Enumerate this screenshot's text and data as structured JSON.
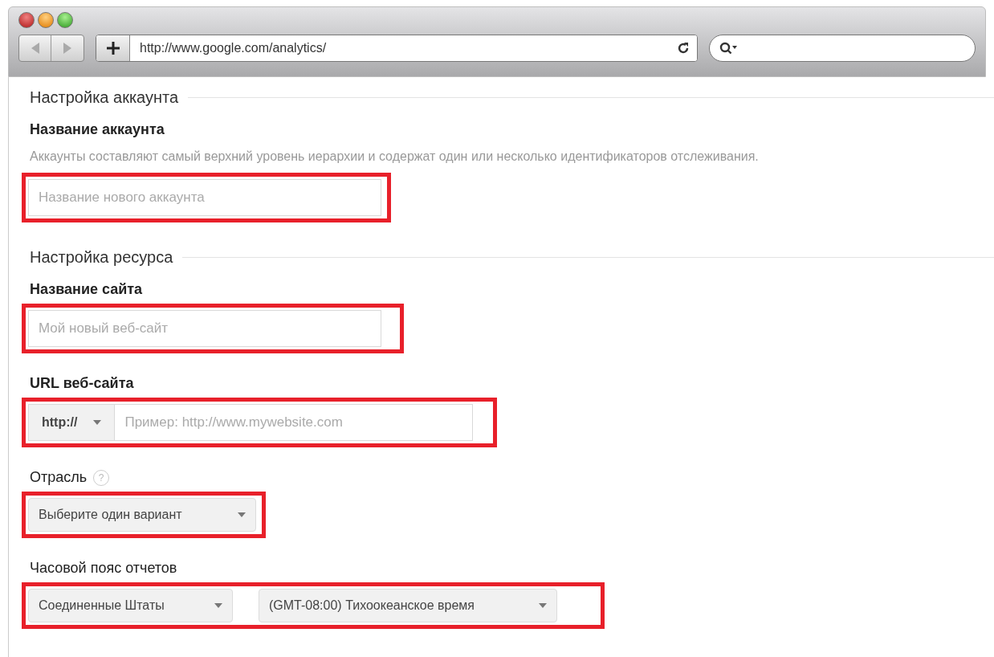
{
  "browser": {
    "url": "http://www.google.com/analytics/"
  },
  "sections": [
    {
      "title": "Настройка аккаунта",
      "fields": [
        {
          "kind": "text",
          "label": "Название аккаунта",
          "help": "Аккаунты составляют самый верхний уровень иерархии и содержат один или несколько идентификаторов отслеживания.",
          "placeholder": "Название нового аккаунта",
          "highlighted": true
        }
      ]
    },
    {
      "title": "Настройка ресурса",
      "fields": [
        {
          "kind": "text",
          "label": "Название сайта",
          "placeholder": "Мой новый веб-сайт",
          "highlighted": true
        },
        {
          "kind": "url",
          "label": "URL веб-сайта",
          "protocol": "http://",
          "placeholder": "Пример: http://www.mywebsite.com",
          "highlighted": true
        },
        {
          "kind": "select",
          "label": "Отрасль",
          "help_icon": "?",
          "selects": [
            "Выберите один вариант"
          ],
          "highlighted": true
        },
        {
          "kind": "select",
          "label": "Часовой пояс отчетов",
          "selects": [
            "Соединенные Штаты",
            "(GMT-08:00) Тихоокеанское время"
          ],
          "highlighted": true
        }
      ]
    }
  ]
}
